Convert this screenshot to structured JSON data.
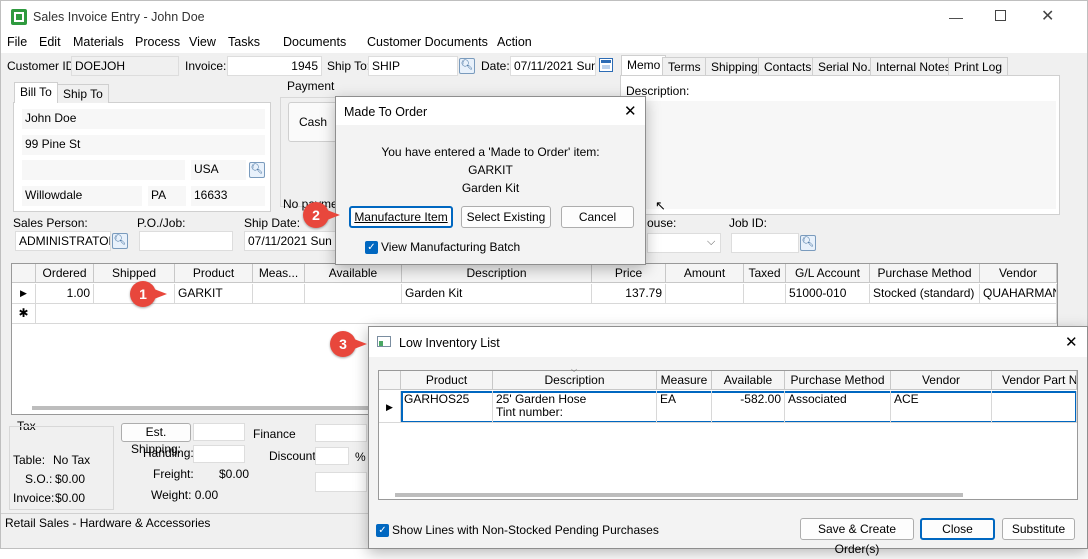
{
  "window": {
    "title": "Sales Invoice Entry - John Doe"
  },
  "menu": [
    "File",
    "Edit",
    "Materials",
    "Process",
    "View",
    "Tasks",
    "Documents",
    "Customer Documents",
    "Action"
  ],
  "header": {
    "customer_id_label": "Customer ID:",
    "customer_id": "DOEJOH",
    "invoice_label": "Invoice:",
    "invoice": "1945",
    "ship_to_label": "Ship To:",
    "ship_to": "SHIP",
    "date_label": "Date:",
    "date": "07/11/2021 Sun"
  },
  "address_tabs": [
    "Bill To",
    "Ship To"
  ],
  "address": {
    "name": "John Doe",
    "street": "99 Pine St",
    "country": "USA",
    "city": "Willowdale",
    "state": "PA",
    "zip": "16633"
  },
  "payment": {
    "group_label": "Payment",
    "cash_label": "Cash",
    "no_payment": "No payment"
  },
  "right_tabs": [
    "Memo",
    "Terms",
    "Shipping",
    "Contacts",
    "Serial No.",
    "Internal Notes",
    "Print Log"
  ],
  "memo": {
    "description_label": "Description:"
  },
  "row2": {
    "sales_person_label": "Sales Person:",
    "sales_person": "ADMINISTRATOR",
    "po_label": "P.O./Job:",
    "ship_date_label": "Ship Date:",
    "ship_date": "07/11/2021 Sun",
    "warehouse_label": "ouse:",
    "job_id_label": "Job ID:"
  },
  "main_grid": {
    "columns": [
      "Ordered",
      "Shipped",
      "Product",
      "Meas...",
      "Available",
      "Description",
      "Price",
      "Amount",
      "Taxed",
      "G/L Account",
      "Purchase Method",
      "Vendor"
    ],
    "rows": [
      {
        "ordered": "1.00",
        "shipped": "",
        "product": "GARKIT",
        "measure": "",
        "available": "",
        "description": "Garden Kit",
        "price": "137.79",
        "amount": "",
        "taxed": "",
        "gl_account": "51000-010",
        "purchase_method": "Stocked (standard)",
        "vendor": "QUAHARMAN"
      }
    ],
    "new_row_marker": "✱"
  },
  "totals": {
    "tax_group": "Tax",
    "table_label": "Table:",
    "table_value": "No Tax",
    "so_label": "S.O.:",
    "so_value": "$0.00",
    "invoice_label": "Invoice:",
    "invoice_value": "$0.00",
    "est_shipping_label": "Est. Shipping:",
    "handling_label": "Handling:",
    "freight_label": "Freight:",
    "freight_value": "$0.00",
    "weight_label": "Weight: 0.00",
    "finance_label": "Finance",
    "discount_label": "Discount:",
    "percent": "%"
  },
  "status_bar": "Retail Sales - Hardware & Accessories",
  "made_to_order": {
    "title": "Made To Order",
    "message": "You have entered a 'Made to Order' item:",
    "item_code": "GARKIT",
    "item_name": "Garden Kit",
    "manufacture_button": "Manufacture Item",
    "select_existing_button": "Select Existing",
    "cancel_button": "Cancel",
    "view_batch_label": "View Manufacturing Batch"
  },
  "low_inventory": {
    "title": "Low Inventory List",
    "columns": [
      "Product",
      "Description",
      "Measure",
      "Available",
      "Purchase Method",
      "Vendor",
      "Vendor Part Nu"
    ],
    "rows": [
      {
        "product": "GARHOS25",
        "description": "25' Garden Hose",
        "tint": "Tint number:",
        "measure": "EA",
        "available": "-582.00",
        "purchase_method": "Associated",
        "vendor": "ACE",
        "vendor_part": ""
      }
    ],
    "show_lines_label": "Show Lines with Non-Stocked Pending Purchases",
    "save_create_button": "Save & Create Order(s)",
    "close_button": "Close",
    "substitute_button": "Substitute"
  },
  "callouts": [
    "1",
    "2",
    "3"
  ],
  "colors": {
    "callout": "#e8473c",
    "accent": "#0067c0",
    "selection_border": "#0067c0"
  }
}
